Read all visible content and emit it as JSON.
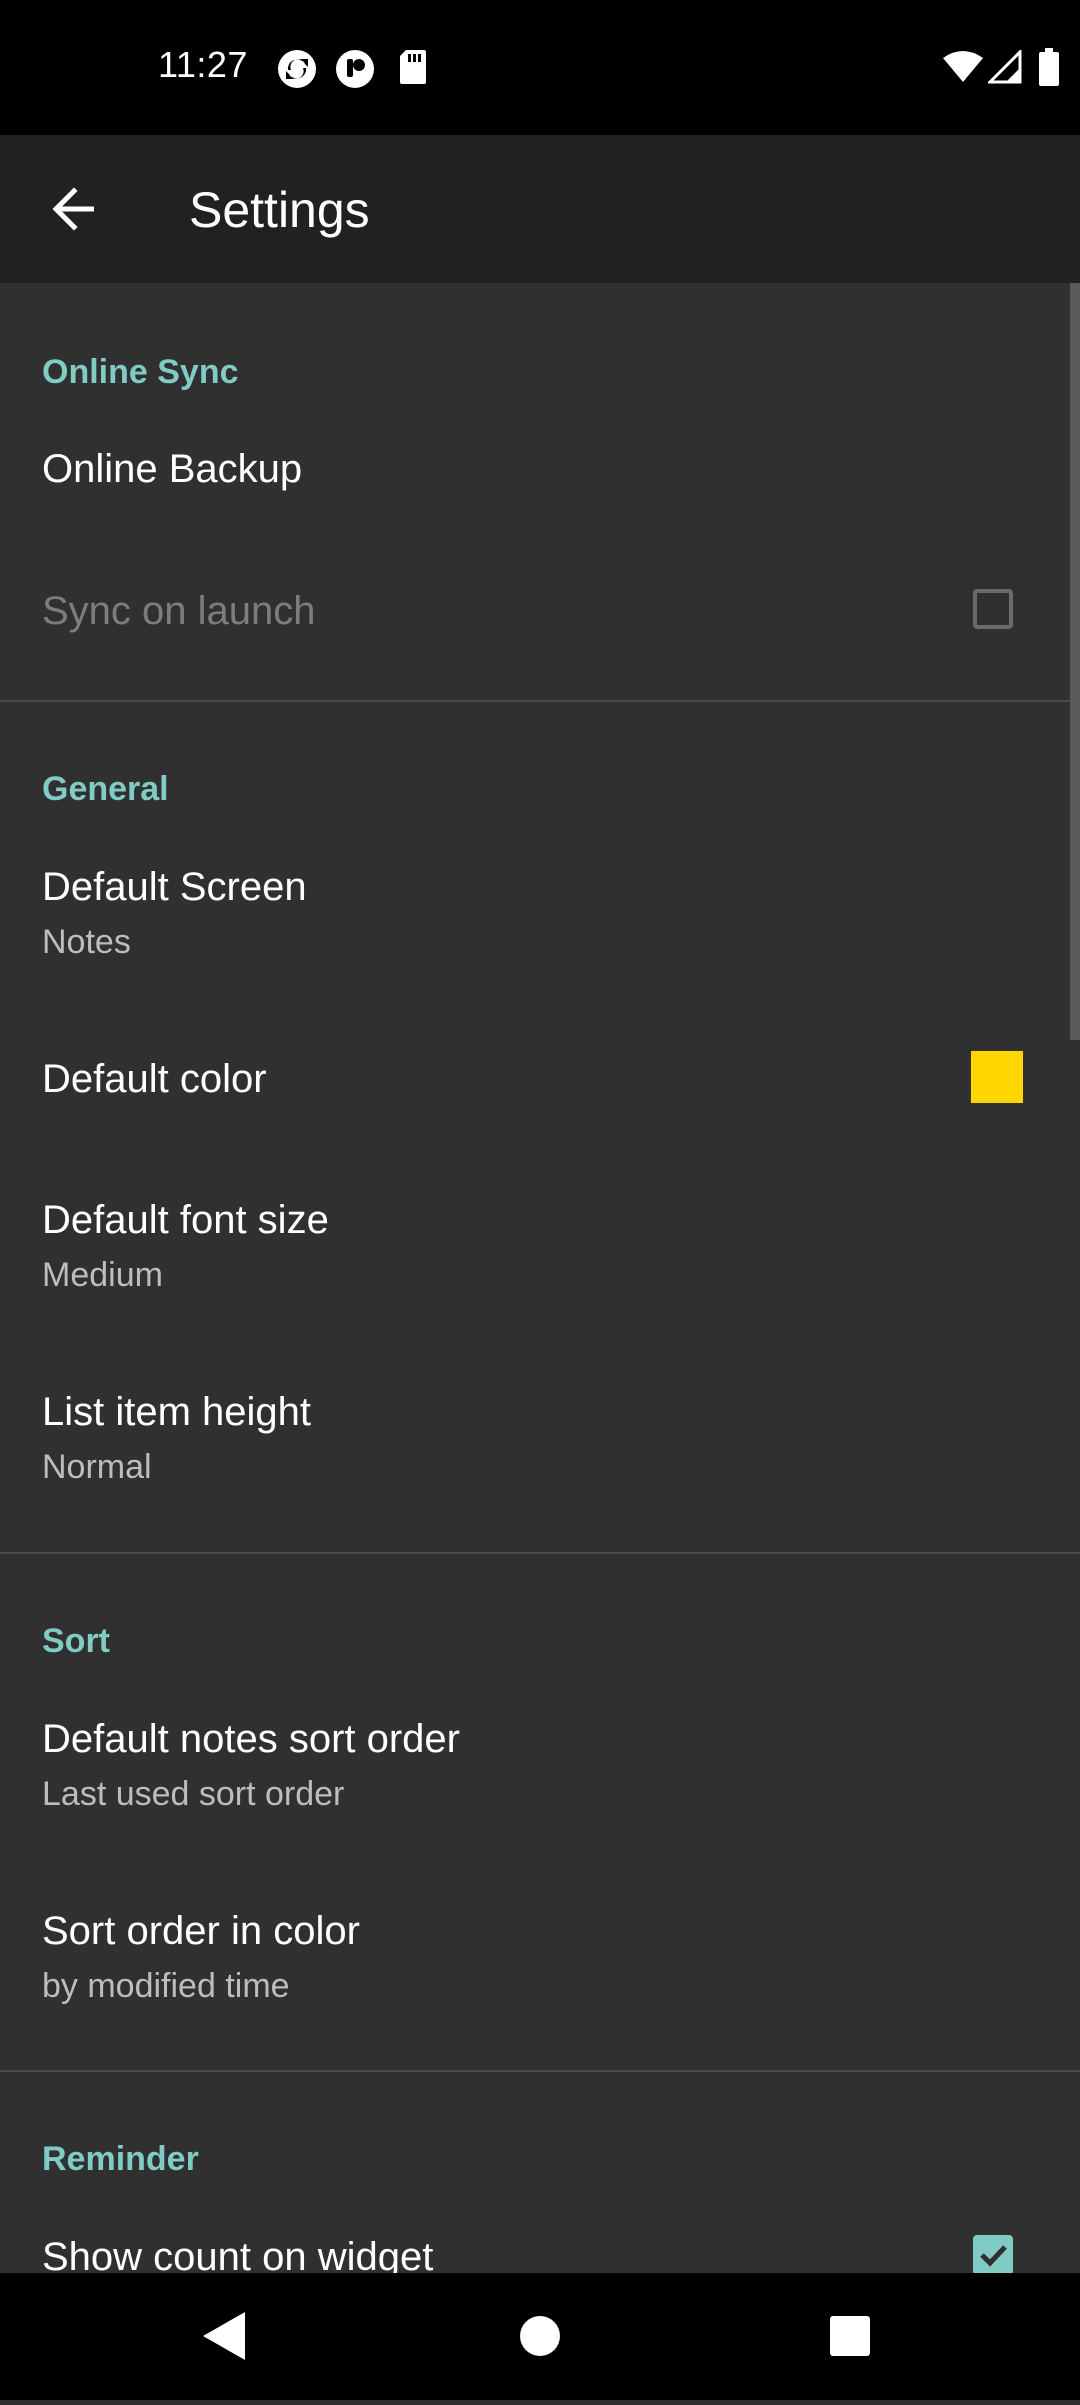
{
  "status_bar": {
    "time": "11:27",
    "icons": [
      "sync-icon",
      "app-icon",
      "sd-card-icon",
      "wifi-icon",
      "signal-icon",
      "battery-icon"
    ]
  },
  "app_bar": {
    "title": "Settings",
    "back_icon": "arrow-left-icon"
  },
  "sections": {
    "online_sync": {
      "header": "Online Sync",
      "online_backup": "Online Backup",
      "sync_on_launch": "Sync on launch",
      "sync_on_launch_checked": false
    },
    "general": {
      "header": "General",
      "default_screen": "Default Screen",
      "default_screen_value": "Notes",
      "default_color": "Default color",
      "default_color_value": "#ffd600",
      "default_font_size": "Default font size",
      "default_font_size_value": "Medium",
      "list_item_height": "List item height",
      "list_item_height_value": "Normal"
    },
    "sort": {
      "header": "Sort",
      "default_notes_sort_order": "Default notes sort order",
      "default_notes_sort_order_value": "Last used sort order",
      "sort_order_in_color": "Sort order in color",
      "sort_order_in_color_value": "by modified time"
    },
    "reminder": {
      "header": "Reminder",
      "show_count_on_widget": "Show count on widget",
      "show_count_on_widget_checked": true
    }
  },
  "colors": {
    "accent": "#80cbc4",
    "background": "#303030",
    "app_bar": "#212121"
  },
  "nav_bar": {
    "buttons": [
      "back-triangle-icon",
      "home-circle-icon",
      "recents-square-icon"
    ]
  }
}
